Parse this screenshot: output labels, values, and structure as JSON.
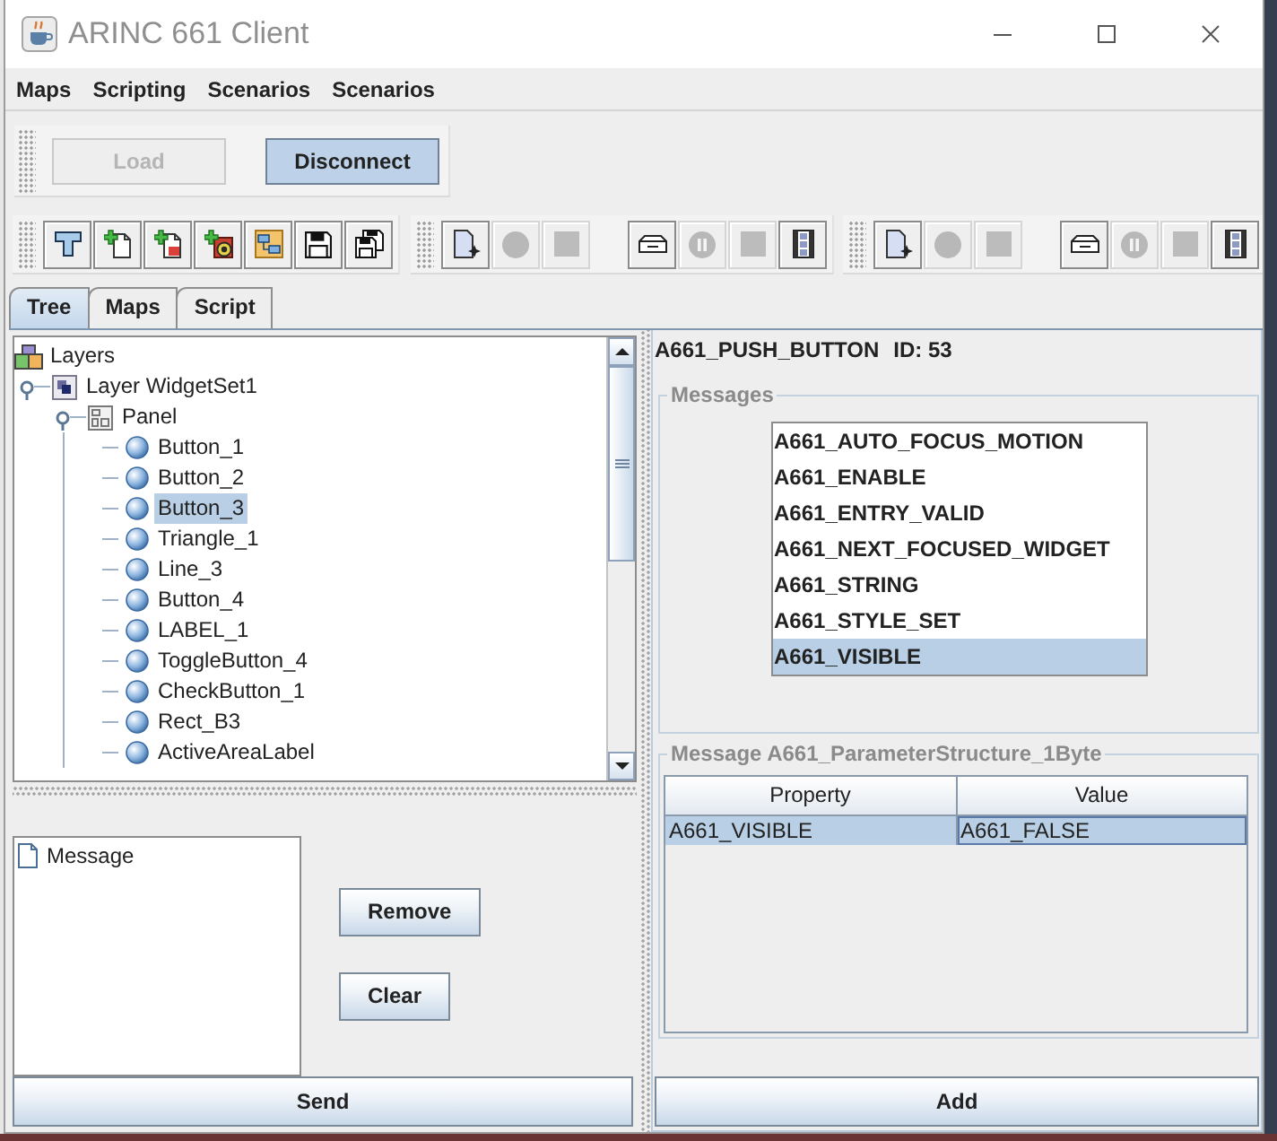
{
  "window": {
    "title": "ARINC 661 Client"
  },
  "menu": [
    "Maps",
    "Scripting",
    "Scenarios",
    "Scenarios"
  ],
  "connection": {
    "buttons": [
      {
        "label": "Load",
        "disabled": true,
        "highlighted": false
      },
      {
        "label": "Disconnect",
        "disabled": false,
        "highlighted": true
      }
    ]
  },
  "toolbars": [
    {
      "clusters": [
        [
          {
            "kind": "tool",
            "disabled": false
          },
          {
            "kind": "new-document",
            "disabled": false
          },
          {
            "kind": "new-script",
            "disabled": false
          },
          {
            "kind": "add-media",
            "disabled": false
          },
          {
            "kind": "diagram",
            "disabled": false
          },
          {
            "kind": "save",
            "disabled": false
          },
          {
            "kind": "save-all",
            "disabled": false
          }
        ]
      ]
    },
    {
      "clusters": [
        [
          {
            "kind": "new-file",
            "disabled": false
          },
          {
            "kind": "record",
            "disabled": true
          },
          {
            "kind": "stop",
            "disabled": true
          }
        ],
        [
          {
            "kind": "folder",
            "disabled": false
          },
          {
            "kind": "pause",
            "disabled": true
          },
          {
            "kind": "stop",
            "disabled": true
          },
          {
            "kind": "film",
            "disabled": false
          }
        ]
      ]
    },
    {
      "clusters": [
        [
          {
            "kind": "new-file",
            "disabled": false
          },
          {
            "kind": "record",
            "disabled": true
          },
          {
            "kind": "stop",
            "disabled": true
          }
        ],
        [
          {
            "kind": "folder",
            "disabled": false
          },
          {
            "kind": "pause",
            "disabled": true
          },
          {
            "kind": "stop",
            "disabled": true
          },
          {
            "kind": "film",
            "disabled": false
          }
        ]
      ]
    }
  ],
  "tabs": [
    {
      "label": "Tree",
      "selected": true
    },
    {
      "label": "Maps",
      "selected": false
    },
    {
      "label": "Script",
      "selected": false
    }
  ],
  "tree": {
    "nodes": [
      {
        "label": "Layers",
        "kind": "layers",
        "selected": false,
        "children": [
          {
            "label": "Layer WidgetSet1",
            "kind": "layer",
            "expanded": true,
            "selected": false,
            "children": [
              {
                "label": "Panel",
                "kind": "panel",
                "expanded": true,
                "selected": false,
                "children": [
                  {
                    "label": "Button_1",
                    "kind": "widget",
                    "selected": false
                  },
                  {
                    "label": "Button_2",
                    "kind": "widget",
                    "selected": false
                  },
                  {
                    "label": "Button_3",
                    "kind": "widget",
                    "selected": true
                  },
                  {
                    "label": "Triangle_1",
                    "kind": "widget",
                    "selected": false
                  },
                  {
                    "label": "Line_3",
                    "kind": "widget",
                    "selected": false
                  },
                  {
                    "label": "Button_4",
                    "kind": "widget",
                    "selected": false
                  },
                  {
                    "label": "LABEL_1",
                    "kind": "widget",
                    "selected": false
                  },
                  {
                    "label": "ToggleButton_4",
                    "kind": "widget",
                    "selected": false
                  },
                  {
                    "label": "CheckButton_1",
                    "kind": "widget",
                    "selected": false
                  },
                  {
                    "label": "Rect_B3",
                    "kind": "widget",
                    "selected": false
                  },
                  {
                    "label": "ActiveAreaLabel",
                    "kind": "widget",
                    "selected": false
                  }
                ]
              }
            ]
          }
        ]
      }
    ]
  },
  "queue": {
    "items": [
      {
        "label": "Message",
        "selected": false
      }
    ]
  },
  "queue_buttons": [
    "Remove",
    "Clear"
  ],
  "send_button": "Send",
  "widget": {
    "type": "A661_PUSH_BUTTON",
    "id": "ID: 53"
  },
  "messages": {
    "title": "Messages",
    "items": [
      {
        "label": "A661_AUTO_FOCUS_MOTION",
        "selected": false
      },
      {
        "label": "A661_ENABLE",
        "selected": false
      },
      {
        "label": "A661_ENTRY_VALID",
        "selected": false
      },
      {
        "label": "A661_NEXT_FOCUSED_WIDGET",
        "selected": false
      },
      {
        "label": "A661_STRING",
        "selected": false
      },
      {
        "label": "A661_STYLE_SET",
        "selected": false
      },
      {
        "label": "A661_VISIBLE",
        "selected": true
      }
    ]
  },
  "parameters": {
    "title": "Message A661_ParameterStructure_1Byte",
    "columns": [
      "Property",
      "Value"
    ],
    "rows": [
      {
        "selected": true,
        "cells": [
          {
            "text": "A661_VISIBLE",
            "focused": false
          },
          {
            "text": "A661_FALSE",
            "focused": true
          }
        ]
      }
    ]
  },
  "add_button": "Add"
}
